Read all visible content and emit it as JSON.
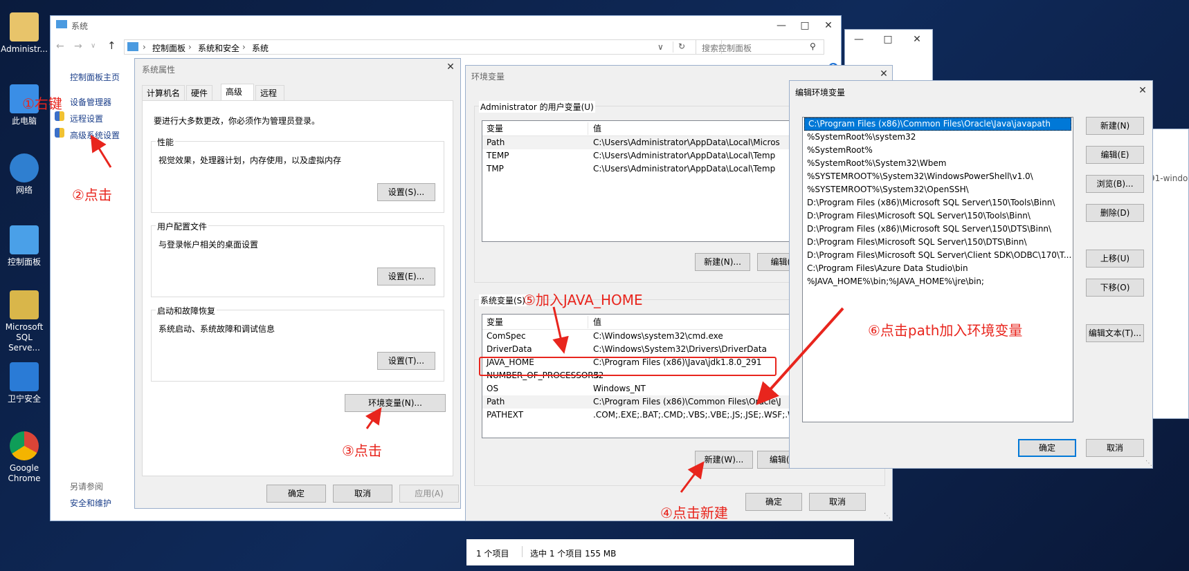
{
  "desktop": {
    "icons": [
      {
        "label": "Administr..."
      },
      {
        "label": "此电脑"
      },
      {
        "label": "网络"
      },
      {
        "label": "控制面板"
      },
      {
        "label": "Microsoft SQL Serve..."
      },
      {
        "label": "卫宁安全"
      },
      {
        "label": "Google Chrome"
      }
    ]
  },
  "system_window": {
    "title": "系统",
    "breadcrumb": [
      "控制面板",
      "系统和安全",
      "系统"
    ],
    "search_placeholder": "搜索控制面板",
    "sidebar": {
      "home": "控制面板主页",
      "items": [
        "设备管理器",
        "远程设置",
        "高级系统设置"
      ],
      "see_also": "另请参阅",
      "security": "安全和维护"
    }
  },
  "sys_props": {
    "title": "系统属性",
    "tabs": [
      "计算机名",
      "硬件",
      "高级",
      "远程"
    ],
    "active_tab": "高级",
    "admin_note": "要进行大多数更改，你必须作为管理员登录。",
    "perf_title": "性能",
    "perf_desc": "视觉效果，处理器计划，内存使用，以及虚拟内存",
    "perf_btn": "设置(S)...",
    "profile_title": "用户配置文件",
    "profile_desc": "与登录帐户相关的桌面设置",
    "profile_btn": "设置(E)...",
    "startup_title": "启动和故障恢复",
    "startup_desc": "系统启动、系统故障和调试信息",
    "startup_btn": "设置(T)...",
    "env_btn": "环境变量(N)...",
    "ok": "确定",
    "cancel": "取消",
    "apply": "应用(A)"
  },
  "env_vars": {
    "title": "环境变量",
    "user_group": "Administrator 的用户变量(U)",
    "col_var": "变量",
    "col_val": "值",
    "user_rows": [
      {
        "name": "Path",
        "value": "C:\\Users\\Administrator\\AppData\\Local\\Micros"
      },
      {
        "name": "TEMP",
        "value": "C:\\Users\\Administrator\\AppData\\Local\\Temp"
      },
      {
        "name": "TMP",
        "value": "C:\\Users\\Administrator\\AppData\\Local\\Temp"
      }
    ],
    "user_new": "新建(N)...",
    "user_edit": "编辑(E)",
    "sys_group": "系统变量(S)",
    "sys_rows": [
      {
        "name": "ComSpec",
        "value": "C:\\Windows\\system32\\cmd.exe"
      },
      {
        "name": "DriverData",
        "value": "C:\\Windows\\System32\\Drivers\\DriverData"
      },
      {
        "name": "JAVA_HOME",
        "value": "C:\\Program Files (x86)\\Java\\jdk1.8.0_291"
      },
      {
        "name": "NUMBER_OF_PROCESSORS",
        "value": "32"
      },
      {
        "name": "OS",
        "value": "Windows_NT"
      },
      {
        "name": "Path",
        "value": "C:\\Program Files (x86)\\Common Files\\Oracle\\J"
      },
      {
        "name": "PATHEXT",
        "value": ".COM;.EXE;.BAT;.CMD;.VBS;.VBE;.JS;.JSE;.WSF;.W"
      }
    ],
    "sys_new": "新建(W)...",
    "sys_edit": "编辑(I)...",
    "ok": "确定",
    "cancel": "取消"
  },
  "edit_env": {
    "title": "编辑环境变量",
    "entries": [
      "C:\\Program Files (x86)\\Common Files\\Oracle\\Java\\javapath",
      "%SystemRoot%\\system32",
      "%SystemRoot%",
      "%SystemRoot%\\System32\\Wbem",
      "%SYSTEMROOT%\\System32\\WindowsPowerShell\\v1.0\\",
      "%SYSTEMROOT%\\System32\\OpenSSH\\",
      "D:\\Program Files (x86)\\Microsoft SQL Server\\150\\Tools\\Binn\\",
      "D:\\Program Files\\Microsoft SQL Server\\150\\Tools\\Binn\\",
      "D:\\Program Files (x86)\\Microsoft SQL Server\\150\\DTS\\Binn\\",
      "D:\\Program Files\\Microsoft SQL Server\\150\\DTS\\Binn\\",
      "D:\\Program Files\\Microsoft SQL Server\\Client SDK\\ODBC\\170\\T...",
      "C:\\Program Files\\Azure Data Studio\\bin",
      "%JAVA_HOME%\\bin;%JAVA_HOME%\\jre\\bin;"
    ],
    "buttons": [
      "新建(N)",
      "编辑(E)",
      "浏览(B)...",
      "删除(D)",
      "上移(U)",
      "下移(O)",
      "编辑文本(T)..."
    ],
    "ok": "确定",
    "cancel": "取消"
  },
  "background_window": {
    "status_items": "1 个项目",
    "status_selected": "选中 1 个项目  155 MB",
    "partial_text": "91-windo"
  },
  "annotations": {
    "a1": "①右键",
    "a2": "②点击",
    "a3": "③点击",
    "a4": "④点击新建",
    "a5": "⑤加入JAVA_HOME",
    "a6": "⑥点击path加入环境变量"
  },
  "colors": {
    "annotation": "#e8251d",
    "selection": "#0078d7"
  }
}
